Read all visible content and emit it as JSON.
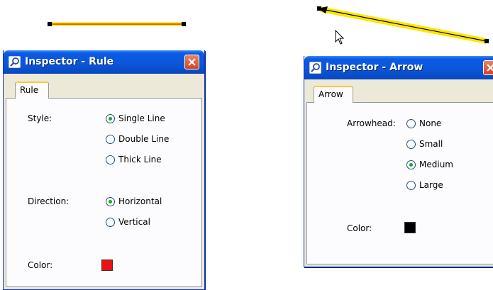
{
  "rule_inspector": {
    "title": "Inspector - Rule",
    "tab_label": "Rule",
    "style_label": "Style:",
    "style_options": [
      {
        "label": "Single Line",
        "checked": true
      },
      {
        "label": "Double Line",
        "checked": false
      },
      {
        "label": "Thick Line",
        "checked": false
      }
    ],
    "direction_label": "Direction:",
    "direction_options": [
      {
        "label": "Horizontal",
        "checked": true
      },
      {
        "label": "Vertical",
        "checked": false
      }
    ],
    "color_label": "Color:",
    "color_value": "#ee1111"
  },
  "arrow_inspector": {
    "title": "Inspector - Arrow",
    "tab_label": "Arrow",
    "arrowhead_label": "Arrowhead:",
    "arrowhead_options": [
      {
        "label": "None",
        "checked": false
      },
      {
        "label": "Small",
        "checked": false
      },
      {
        "label": "Medium",
        "checked": true
      },
      {
        "label": "Large",
        "checked": false
      }
    ],
    "color_label": "Color:",
    "color_value": "#000000"
  },
  "canvas": {
    "rule_color": "#ee1111",
    "selection_highlight": "#ffe600",
    "arrow_color": "#000000"
  }
}
